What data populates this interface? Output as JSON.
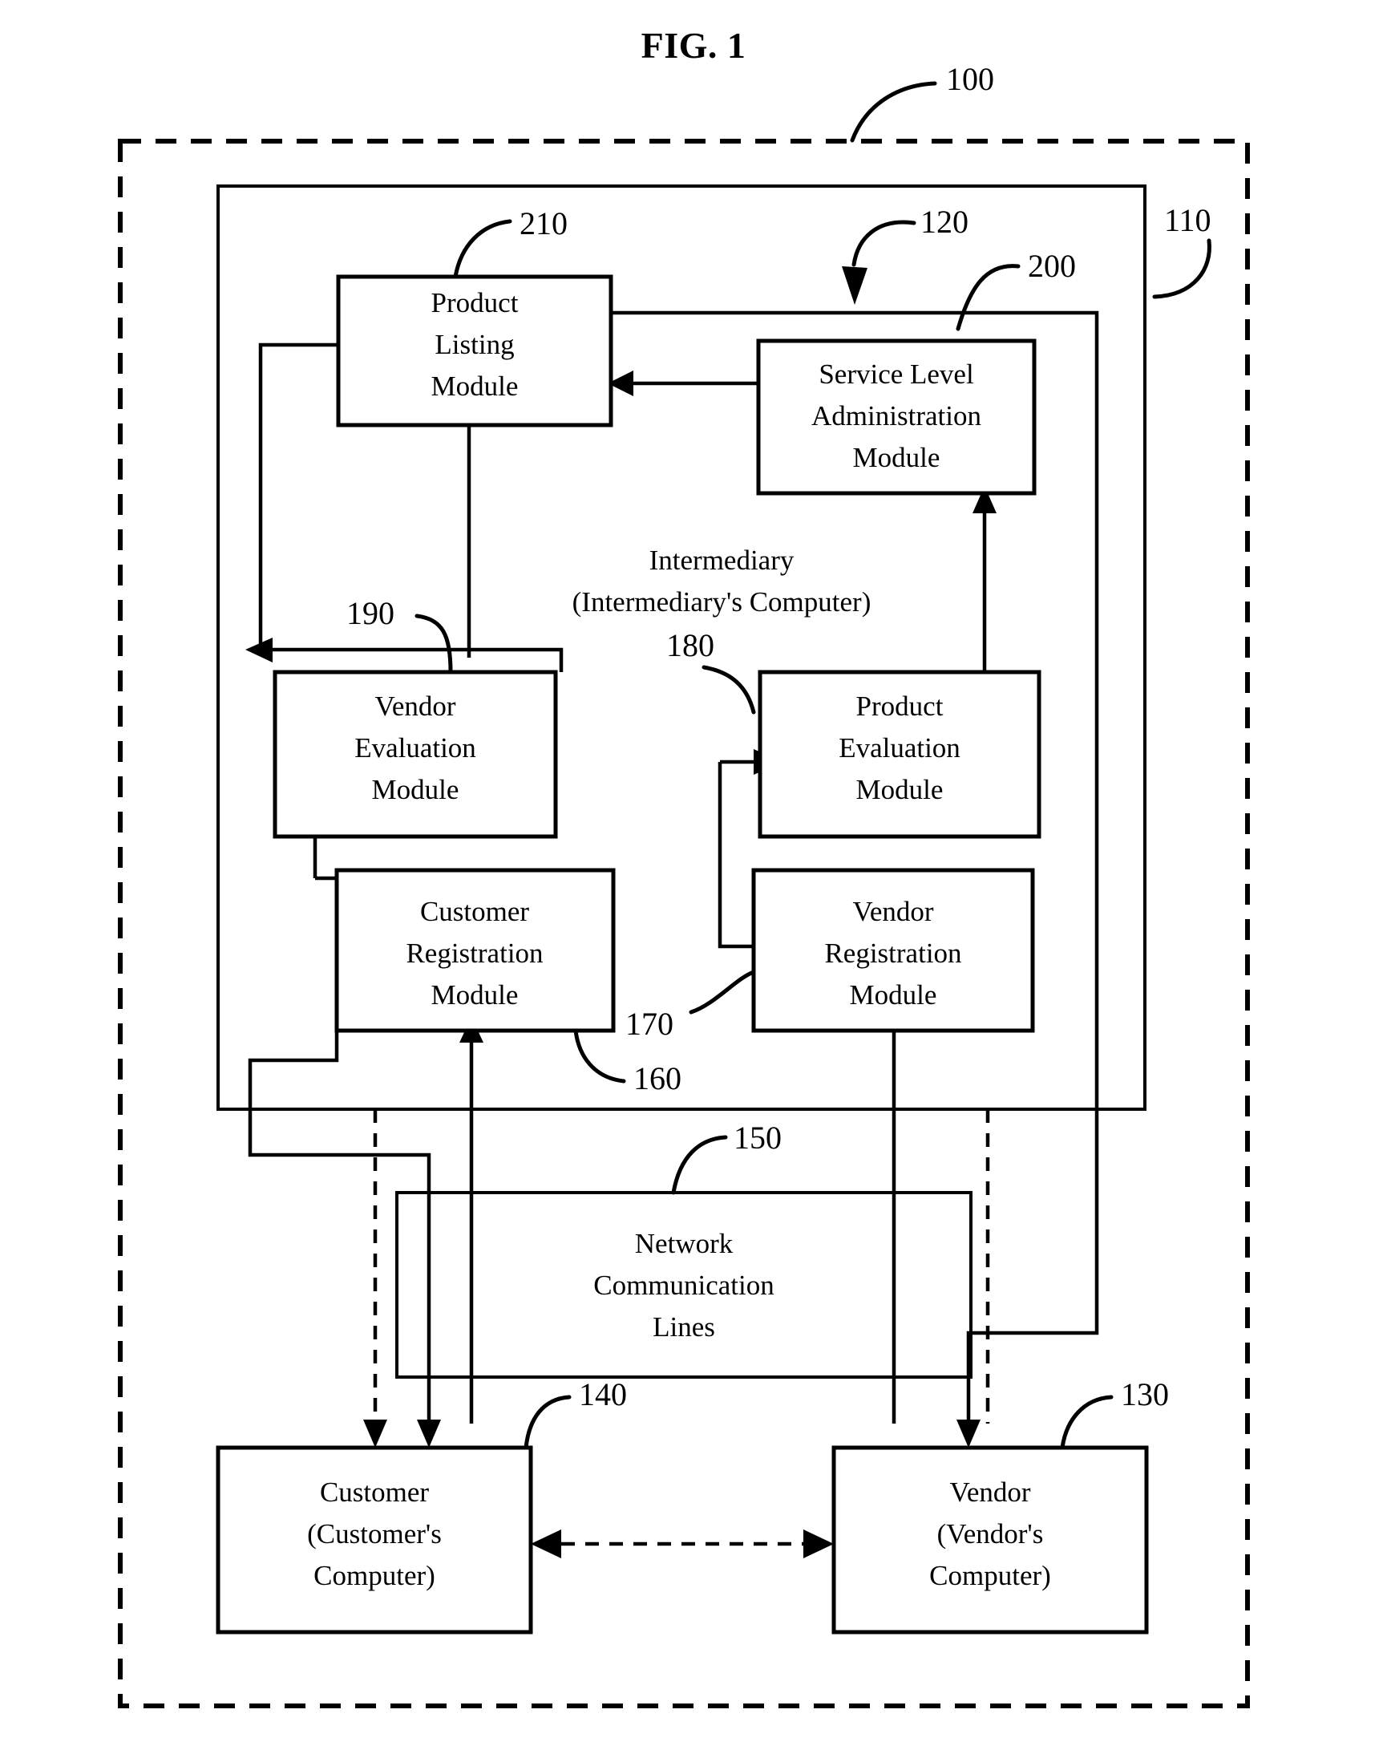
{
  "figure": {
    "title": "FIG. 1",
    "type": "patent-block-diagram"
  },
  "reference_numerals": {
    "system": "100",
    "intermediary_boundary": "110",
    "intermediary_arrow": "120",
    "vendor": "130",
    "customer": "140",
    "network": "150",
    "customer_registration": "160",
    "vendor_registration": "170",
    "product_evaluation": "180",
    "vendor_evaluation": "190",
    "service_level_administration": "200",
    "product_listing": "210"
  },
  "boxes": {
    "product_listing": {
      "lines": [
        "Product",
        "Listing",
        "Module"
      ],
      "ref": "210"
    },
    "service_level": {
      "lines": [
        "Service Level",
        "Administration",
        "Module"
      ],
      "ref": "200"
    },
    "vendor_evaluation": {
      "lines": [
        "Vendor",
        "Evaluation",
        "Module"
      ],
      "ref": "190"
    },
    "product_evaluation": {
      "lines": [
        "Product",
        "Evaluation",
        "Module"
      ],
      "ref": "180"
    },
    "customer_registration": {
      "lines": [
        "Customer",
        "Registration",
        "Module"
      ],
      "ref": "160"
    },
    "vendor_registration": {
      "lines": [
        "Vendor",
        "Registration",
        "Module"
      ],
      "ref": "170"
    },
    "network": {
      "lines": [
        "Network",
        "Communication",
        "Lines"
      ],
      "ref": "150"
    },
    "customer": {
      "lines": [
        "Customer",
        "(Customer's",
        "Computer)"
      ],
      "ref": "140"
    },
    "vendor": {
      "lines": [
        "Vendor",
        "(Vendor's",
        "Computer)"
      ],
      "ref": "130"
    }
  },
  "labels": {
    "intermediary_line1": "Intermediary",
    "intermediary_line2": "(Intermediary's Computer)"
  },
  "colors": {
    "stroke": "#000000",
    "background": "#ffffff"
  }
}
